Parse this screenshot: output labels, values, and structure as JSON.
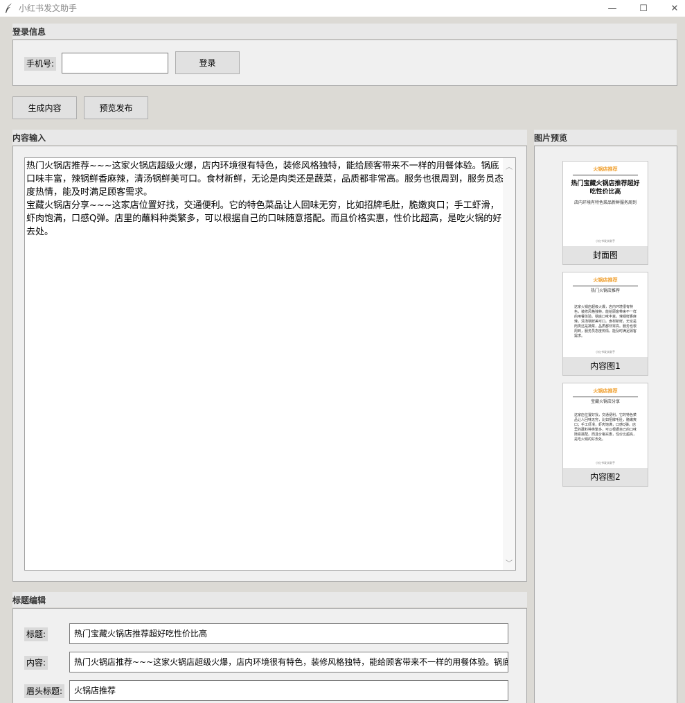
{
  "window": {
    "title": "小红书发文助手",
    "minimize_glyph": "—",
    "maximize_glyph": "☐",
    "close_glyph": "✕"
  },
  "login": {
    "section_title": "登录信息",
    "phone_label": "手机号:",
    "phone_value": "",
    "login_button": "登录"
  },
  "toolbar": {
    "generate_button": "生成内容",
    "preview_button": "预览发布"
  },
  "content_input": {
    "section_title": "内容输入",
    "text": "热门火锅店推荐~~~这家火锅店超级火爆，店内环境很有特色，装修风格独特，能给顾客带来不一样的用餐体验。锅底口味丰富，辣锅鲜香麻辣，清汤锅鲜美可口。食材新鲜，无论是肉类还是蔬菜，品质都非常高。服务也很周到，服务员态度热情，能及时满足顾客需求。\n宝藏火锅店分享~~~这家店位置好找，交通便利。它的特色菜品让人回味无穷，比如招牌毛肚，脆嫩爽口；手工虾滑，虾肉饱满，口感Q弹。店里的蘸料种类繁多，可以根据自己的口味随意搭配。而且价格实惠，性价比超高，是吃火锅的好去处。"
  },
  "title_edit": {
    "section_title": "标题编辑",
    "title_label": "标题:",
    "title_value": "热门宝藏火锅店推荐超好吃性价比高",
    "content_label": "内容:",
    "content_value": "热门火锅店推荐~~~这家火锅店超级火爆，店内环境很有特色，装修风格独特，能给顾客带来不一样的用餐体验。锅底",
    "header_label": "眉头标题:",
    "header_value": "火锅店推荐"
  },
  "preview": {
    "section_title": "图片预览",
    "images": [
      {
        "caption": "封面图",
        "category": "火锅店推荐",
        "title": "热门宝藏火锅店推荐超好吃性价比高",
        "subtitle": "店内环境有特色菜品新鲜服务周到",
        "body": "",
        "footer": "小红书发文助手"
      },
      {
        "caption": "内容图1",
        "category": "火锅店推荐",
        "title": "热门火锅店推荐",
        "subtitle": "",
        "body": "这家火锅店超级火爆，店内环境很有特色，装修风格独特，能给顾客带来不一样的用餐体验。锅底口味丰富，辣锅鲜香麻辣，清汤锅鲜美可口。食材新鲜，无论是肉类还是蔬菜，品质都非常高。服务也很周到，服务员态度热情，能及时满足顾客需求。",
        "footer": "小红书发文助手"
      },
      {
        "caption": "内容图2",
        "category": "火锅店推荐",
        "title": "宝藏火锅店分享",
        "subtitle": "",
        "body": "这家店位置好找，交通便利。它的特色菜品让人回味无穷，比如招牌毛肚，脆嫩爽口；手工虾滑，虾肉饱满，口感Q弹。店里的蘸料种类繁多，可以根据自己的口味随意搭配。而且价格实惠，性价比超高，是吃火锅的好去处。",
        "footer": "小红书发文助手"
      }
    ]
  },
  "colors": {
    "accent_orange": "#f0a030",
    "panel_bg": "#f0f0f0",
    "window_bg": "#dcdad5"
  }
}
